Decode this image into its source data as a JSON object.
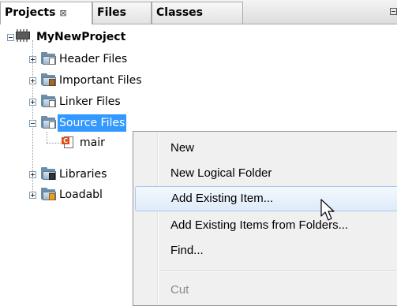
{
  "tabs": [
    {
      "label": "Projects",
      "close_glyph": "⊠",
      "active": true
    },
    {
      "label": "Files",
      "active": false
    },
    {
      "label": "Classes",
      "active": false
    }
  ],
  "tree": {
    "project": {
      "label": "MyNewProject",
      "icon": "chip-icon"
    },
    "items": [
      {
        "label": "Header Files",
        "icon": "folder-icon"
      },
      {
        "label": "Important Files",
        "icon": "folder-icon"
      },
      {
        "label": "Linker Files",
        "icon": "folder-icon"
      },
      {
        "label": "Source Files",
        "icon": "folder-icon",
        "selected": true
      },
      {
        "label": "mair",
        "icon": "c-file-icon",
        "child_of": "Source Files"
      },
      {
        "label": "Libraries",
        "icon": "folder-icon"
      },
      {
        "label": "Loadabl",
        "icon": "folder-icon"
      }
    ]
  },
  "context_menu": {
    "items": [
      {
        "label": "New",
        "enabled": true
      },
      {
        "label": "New Logical Folder",
        "enabled": true
      },
      {
        "label": "Add Existing Item...",
        "enabled": true,
        "hovered": true
      },
      {
        "label": "Add Existing Items from Folders...",
        "enabled": true
      },
      {
        "label": "Find...",
        "enabled": true
      },
      {
        "label": "Cut",
        "enabled": false
      }
    ]
  },
  "colors": {
    "selection": "#3399ff",
    "menu_background": "#f0f0f0",
    "menu_hover": "#deebfa"
  }
}
